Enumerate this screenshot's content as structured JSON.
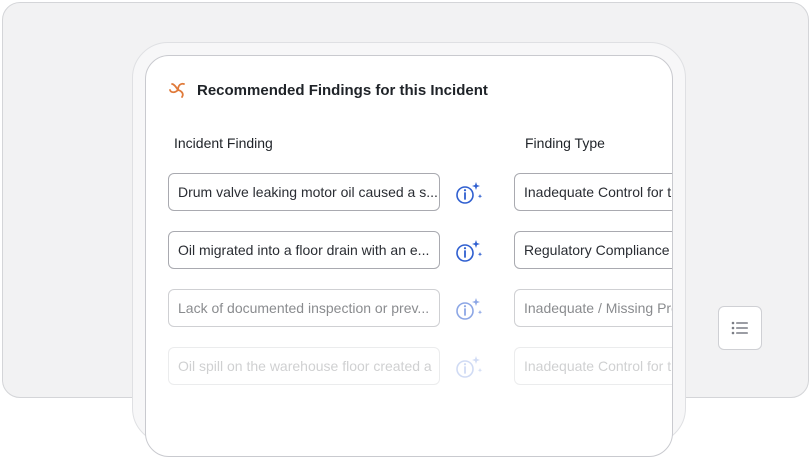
{
  "panel": {
    "title": "Recommended Findings for this Incident",
    "columns": {
      "finding": "Incident Finding",
      "type": "Finding Type"
    },
    "rows": [
      {
        "finding": "Drum valve leaking motor oil caused a s...",
        "type": "Inadequate Control for t"
      },
      {
        "finding": "Oil migrated into a floor drain with an e...",
        "type": "Regulatory Compliance"
      },
      {
        "finding": "Lack of documented inspection or prev...",
        "type": "Inadequate / Missing Pro"
      },
      {
        "finding": "Oil spill on the warehouse floor created a",
        "type": "Inadequate Control for t"
      }
    ]
  },
  "icons": {
    "logo": "spiral-logo-icon",
    "ai_info": "info-sparkle-icon",
    "list": "list-icon"
  },
  "colors": {
    "accent_blue": "#2f5fd0",
    "logo_orange": "#e07a3a"
  }
}
